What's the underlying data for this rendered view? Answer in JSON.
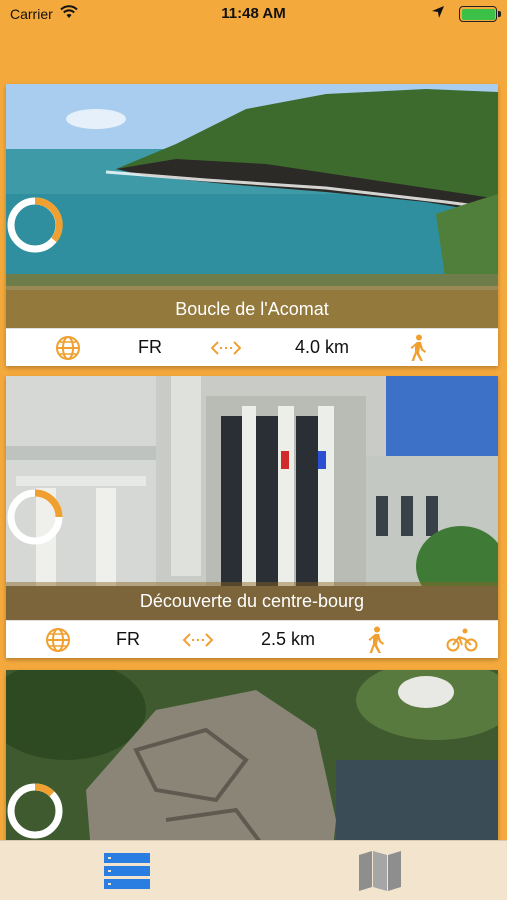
{
  "status_bar": {
    "carrier": "Carrier",
    "time": "11:48 AM",
    "icons": [
      "wifi-icon",
      "location-arrow-icon",
      "battery-icon"
    ]
  },
  "colors": {
    "accent": "#f4a93c",
    "icon_orange": "#f0a030",
    "tab_active": "#2a7de1",
    "tab_inactive": "#8e8e8e"
  },
  "trails": [
    {
      "name": "Boucle de l'Acomat",
      "language": "FR",
      "distance": "4.0 km",
      "modes": [
        "walking-icon"
      ]
    },
    {
      "name": "Découverte du centre-bourg",
      "language": "FR",
      "distance": "2.5 km",
      "modes": [
        "walking-icon",
        "cycling-icon"
      ]
    },
    {
      "name": "",
      "language": "",
      "distance": "",
      "modes": []
    }
  ],
  "tab_bar": {
    "tabs": [
      {
        "icon": "list-icon",
        "active": true
      },
      {
        "icon": "map-icon",
        "active": false
      }
    ]
  }
}
